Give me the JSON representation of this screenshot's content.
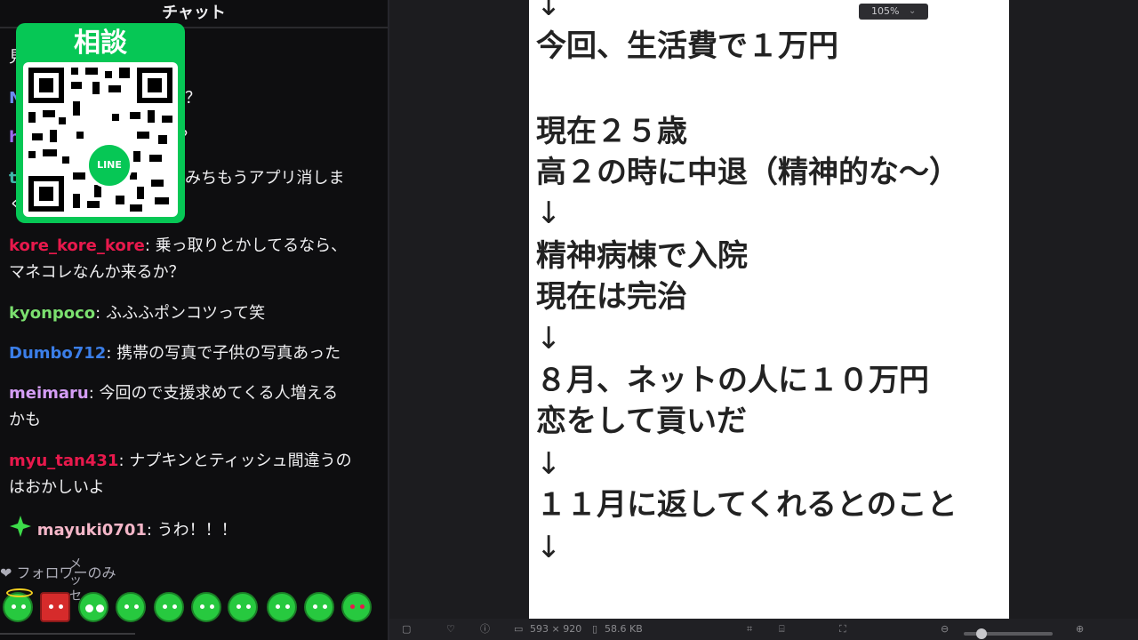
{
  "chat": {
    "header": "チャット",
    "partials": [
      "見",
      "N",
      "？",
      "h",
      "？",
      "t",
      "みちもうアプリ消しま",
      "く"
    ],
    "messages": [
      {
        "user": "kore_kore_kore",
        "text": "乗っ取りとかしてるなら、",
        "text2": "マネコレなんか来るか？",
        "color": "#e8194c"
      },
      {
        "user": "kyonpoco",
        "text": "ふふふポンコツって笑",
        "color": "#7be06f"
      },
      {
        "user": "Dumbo712",
        "text": "携帯の写真で子供の写真あった",
        "color": "#3b7ee8"
      },
      {
        "user": "meimaru",
        "text": "今回ので支援求めてくる人増える",
        "text2": "かも",
        "color": "#d49df5"
      },
      {
        "user": "myu_tan431",
        "text": "ナプキンとティッシュ間違うの",
        "text2": "はおかしいよ",
        "color": "#e8194c"
      },
      {
        "user": "mayuki0701",
        "text": "うわ！！！",
        "color": "#f4b6c8"
      }
    ],
    "qr_title": "相談",
    "qr_badge": "LINE",
    "followers": "フォロワーのみ",
    "vertical_text": "メッセ"
  },
  "document": {
    "lines": [
      "↓",
      "今回、生活費で１万円",
      "現在２５歳",
      "高２の時に中退（精神的な～）",
      "↓",
      "精神病棟で入院",
      "現在は完治",
      "↓",
      "８月、ネットの人に１０万円",
      "恋をして貢いだ",
      "↓",
      "１１月に返してくれるとのこと",
      "↓"
    ]
  },
  "toolbar": {
    "dimensions": "593 × 920",
    "filesize": "58.6 KB",
    "zoom": "105%"
  }
}
